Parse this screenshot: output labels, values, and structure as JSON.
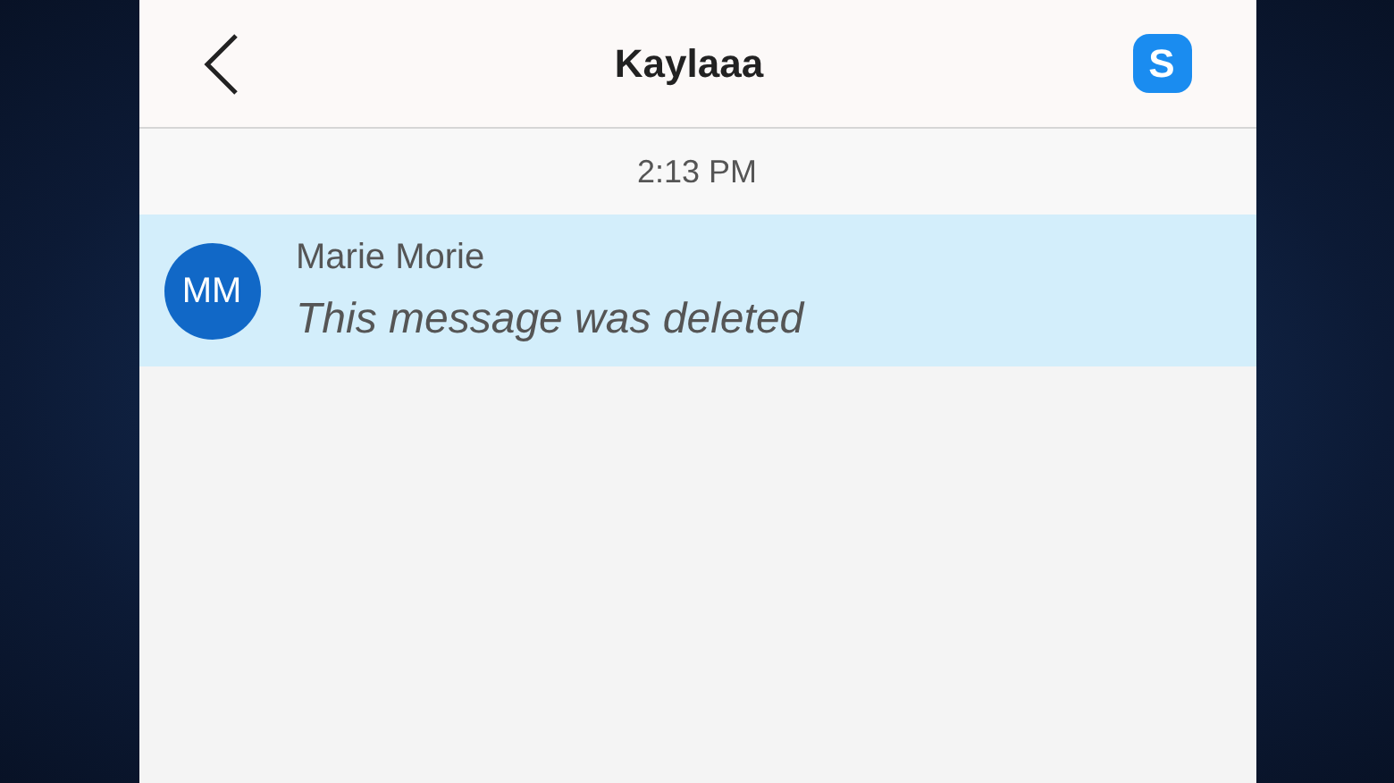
{
  "header": {
    "title": "Kaylaaa",
    "app_badge": "S"
  },
  "timestamp": "2:13 PM",
  "messages": [
    {
      "avatar": "MM",
      "sender": "Marie Morie",
      "text": "This message was deleted",
      "deleted": true,
      "selected": true
    }
  ]
}
